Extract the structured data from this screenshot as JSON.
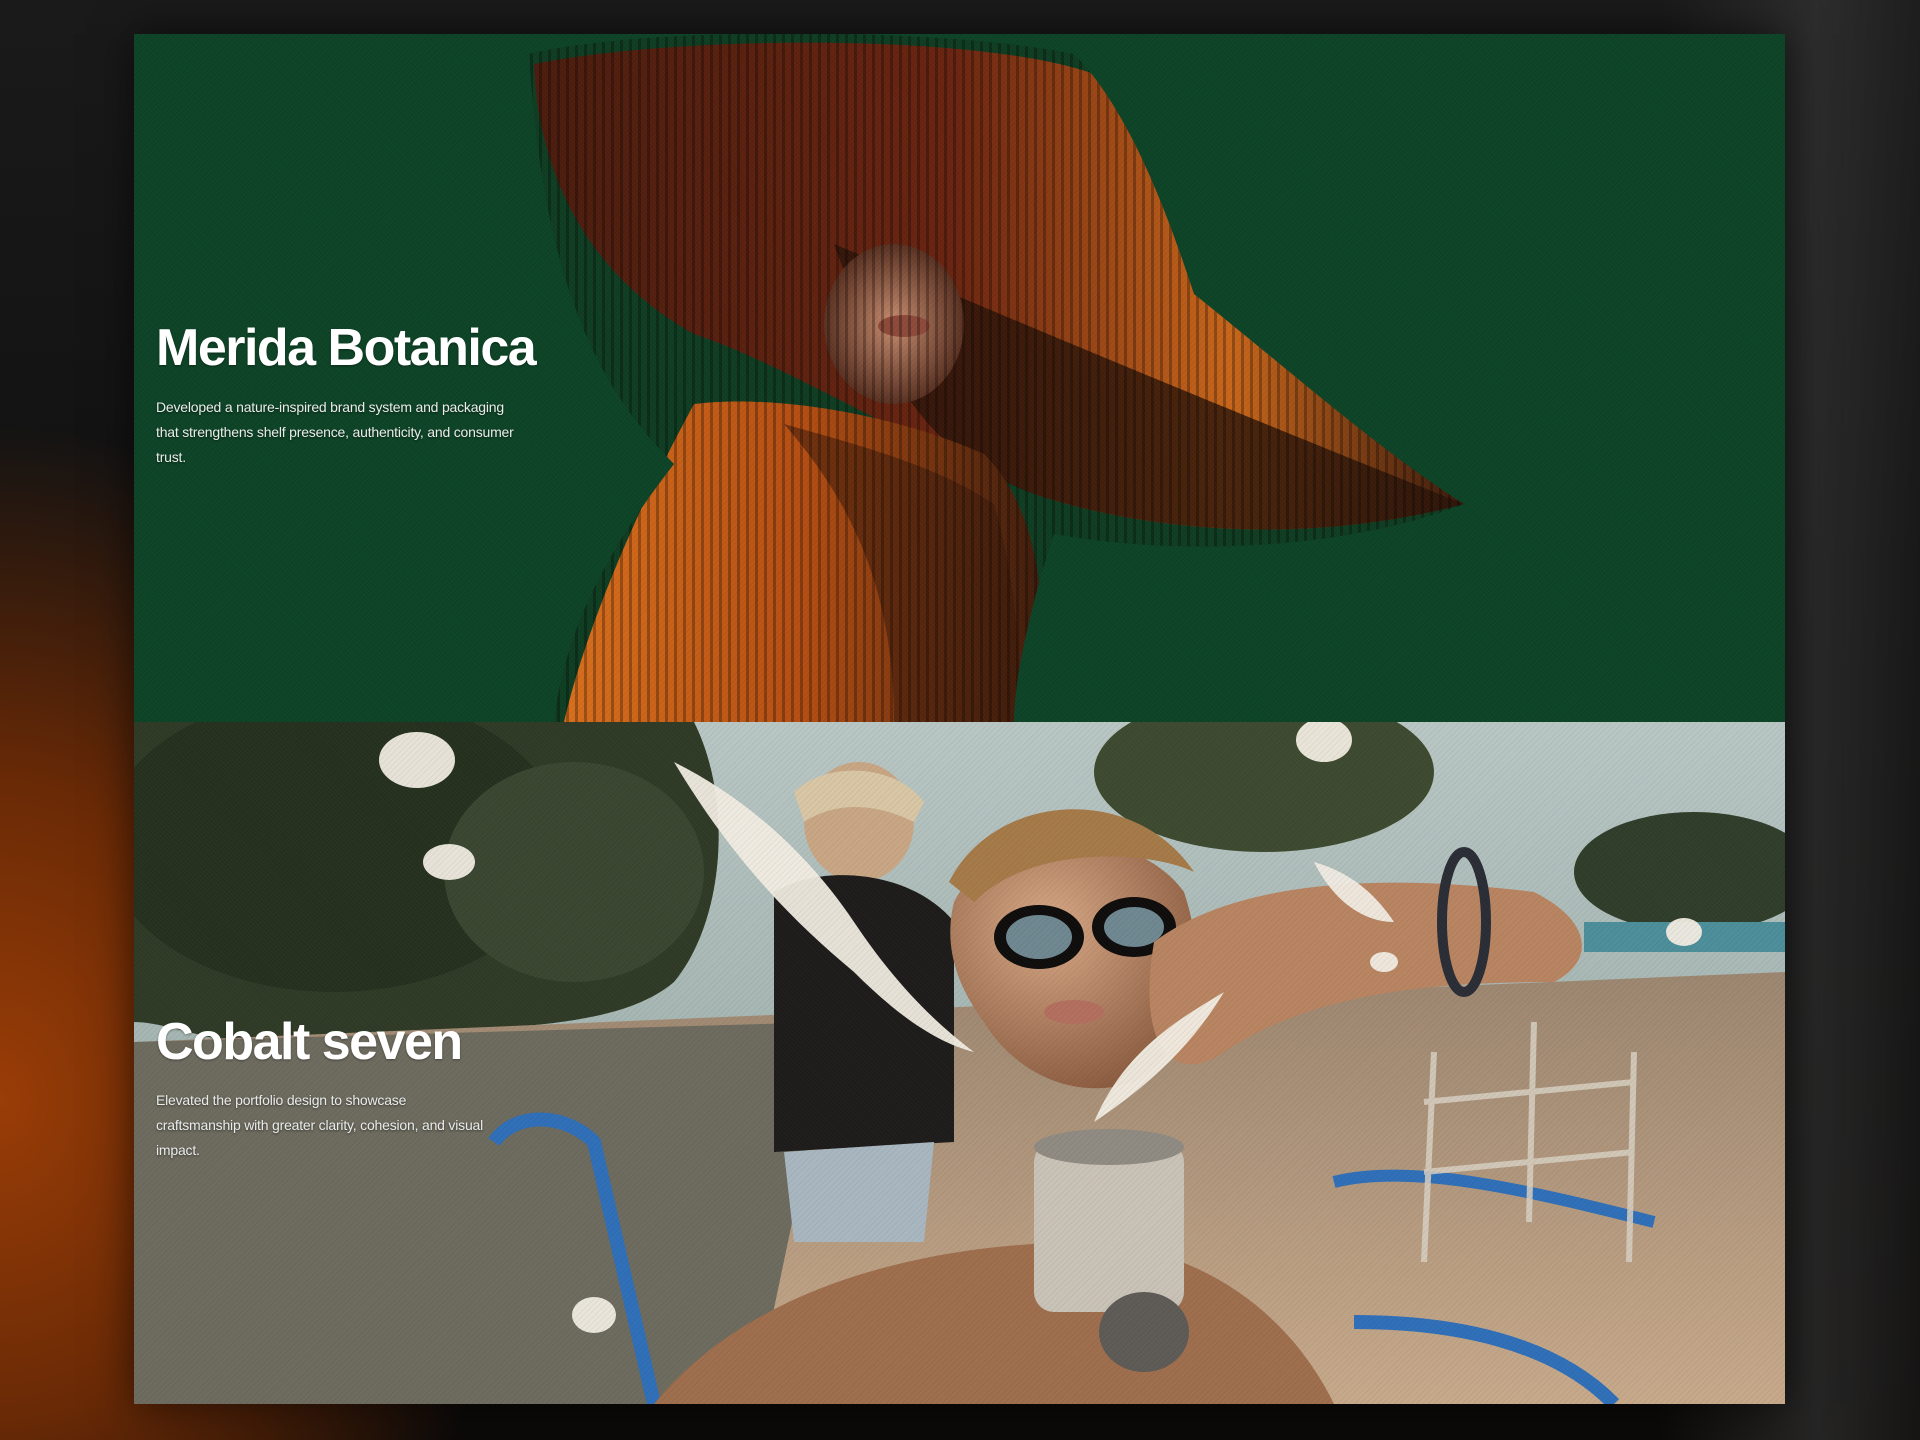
{
  "projects": [
    {
      "title": "Merida Botanica",
      "description": "Developed a nature-inspired brand system and packaging that strengthens shelf presence, authenticity, and consumer trust."
    },
    {
      "title": "Cobalt seven",
      "description": "Elevated the portfolio design to showcase craftsmanship with greater clarity, cohesion, and visual impact."
    }
  ],
  "colors": {
    "botanica_green": "#0d4326",
    "accent_orange": "#d9741a",
    "cobalt_blue": "#2f6fb8"
  }
}
